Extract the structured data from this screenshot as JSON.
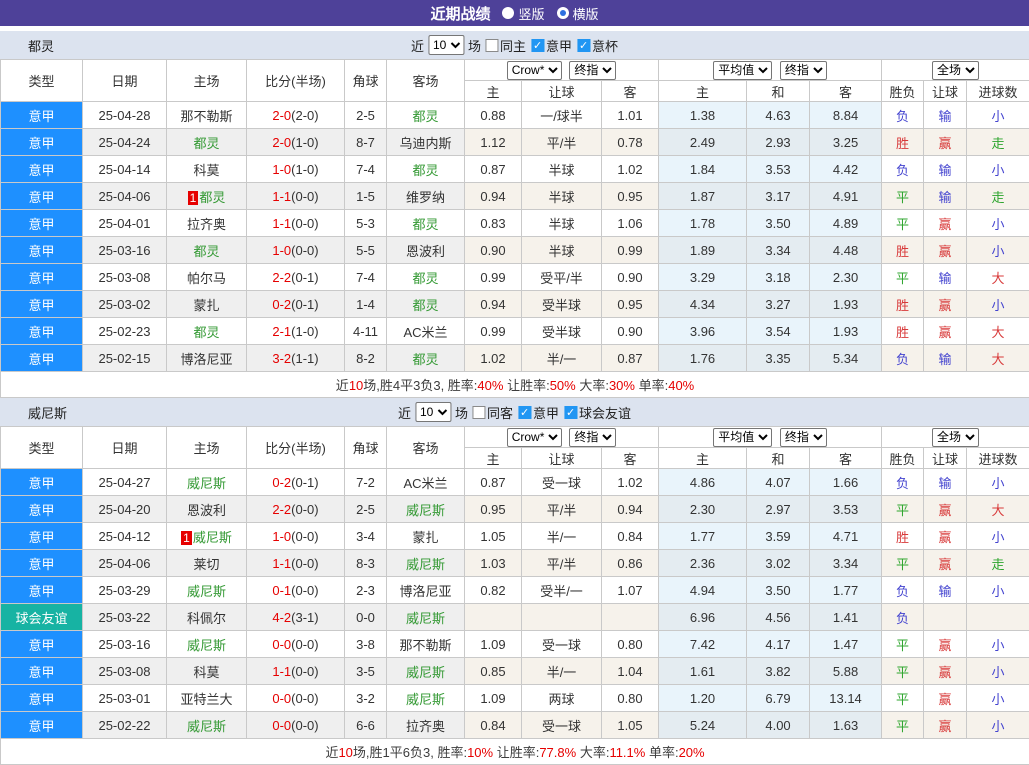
{
  "colors": {
    "title_bg": "#4e4199",
    "section_bg": "#dce3ef",
    "serie_a_cell": "#1E90FF",
    "friendly_cell": "#17b3a3",
    "team_highlight_green": "#339933",
    "score_red": "#e60000",
    "win_red": "#d83a3a",
    "draw_green": "#2ea52e",
    "lose_blue": "#4343cf",
    "avg_col_bg": "#e9f4fb",
    "checkbox_blue": "#2196f3"
  },
  "title_bar": {
    "title": "近期战绩",
    "radios": [
      {
        "label": "竖版",
        "checked": false
      },
      {
        "label": "横版",
        "checked": true
      }
    ]
  },
  "columns": {
    "main": [
      "类型",
      "日期",
      "主场",
      "比分(半场)",
      "角球",
      "客场"
    ],
    "dd": {
      "crow": "Crow*",
      "final1": "终指",
      "avg": "平均值",
      "final2": "终指",
      "full": "全场"
    },
    "sub": [
      "主",
      "让球",
      "客",
      "主",
      "和",
      "客",
      "胜负",
      "让球",
      "进球数"
    ]
  },
  "tables": [
    {
      "team": "都灵",
      "filter": {
        "prefix": "近",
        "count": "10",
        "suffix": "场",
        "checks": [
          {
            "label": "同主",
            "checked": false
          },
          {
            "label": "意甲",
            "checked": true
          },
          {
            "label": "意杯",
            "checked": true
          }
        ]
      },
      "rows": [
        {
          "type": "意甲",
          "style": "serie",
          "date": "25-04-28",
          "home": "那不勒斯",
          "home_green": false,
          "home_badge": "",
          "score_ft": "2-0",
          "score_ht": "(2-0)",
          "corner": "2-5",
          "away": "都灵",
          "away_green": true,
          "crow": [
            "0.88",
            "一/球半",
            "1.01"
          ],
          "avg": [
            "1.38",
            "4.63",
            "8.84"
          ],
          "res": [
            [
              "负",
              "b"
            ],
            [
              "输",
              "b"
            ],
            [
              "小",
              "b"
            ]
          ]
        },
        {
          "type": "意甲",
          "style": "serie",
          "date": "25-04-24",
          "home": "都灵",
          "home_green": true,
          "home_badge": "",
          "score_ft": "2-0",
          "score_ht": "(1-0)",
          "corner": "8-7",
          "away": "乌迪内斯",
          "away_green": false,
          "crow": [
            "1.12",
            "平/半",
            "0.78"
          ],
          "avg": [
            "2.49",
            "2.93",
            "3.25"
          ],
          "res": [
            [
              "胜",
              "r"
            ],
            [
              "赢",
              "r"
            ],
            [
              "走",
              "g"
            ]
          ]
        },
        {
          "type": "意甲",
          "style": "serie",
          "date": "25-04-14",
          "home": "科莫",
          "home_green": false,
          "home_badge": "",
          "score_ft": "1-0",
          "score_ht": "(1-0)",
          "corner": "7-4",
          "away": "都灵",
          "away_green": true,
          "crow": [
            "0.87",
            "半球",
            "1.02"
          ],
          "avg": [
            "1.84",
            "3.53",
            "4.42"
          ],
          "res": [
            [
              "负",
              "b"
            ],
            [
              "输",
              "b"
            ],
            [
              "小",
              "b"
            ]
          ]
        },
        {
          "type": "意甲",
          "style": "serie",
          "date": "25-04-06",
          "home": "都灵",
          "home_green": true,
          "home_badge": "1",
          "score_ft": "1-1",
          "score_ht": "(0-0)",
          "corner": "1-5",
          "away": "维罗纳",
          "away_green": false,
          "crow": [
            "0.94",
            "半球",
            "0.95"
          ],
          "avg": [
            "1.87",
            "3.17",
            "4.91"
          ],
          "res": [
            [
              "平",
              "g"
            ],
            [
              "输",
              "b"
            ],
            [
              "走",
              "g"
            ]
          ]
        },
        {
          "type": "意甲",
          "style": "serie",
          "date": "25-04-01",
          "home": "拉齐奥",
          "home_green": false,
          "home_badge": "",
          "score_ft": "1-1",
          "score_ht": "(0-0)",
          "corner": "5-3",
          "away": "都灵",
          "away_green": true,
          "crow": [
            "0.83",
            "半球",
            "1.06"
          ],
          "avg": [
            "1.78",
            "3.50",
            "4.89"
          ],
          "res": [
            [
              "平",
              "g"
            ],
            [
              "赢",
              "r"
            ],
            [
              "小",
              "b"
            ]
          ]
        },
        {
          "type": "意甲",
          "style": "serie",
          "date": "25-03-16",
          "home": "都灵",
          "home_green": true,
          "home_badge": "",
          "score_ft": "1-0",
          "score_ht": "(0-0)",
          "corner": "5-5",
          "away": "恩波利",
          "away_green": false,
          "crow": [
            "0.90",
            "半球",
            "0.99"
          ],
          "avg": [
            "1.89",
            "3.34",
            "4.48"
          ],
          "res": [
            [
              "胜",
              "r"
            ],
            [
              "赢",
              "r"
            ],
            [
              "小",
              "b"
            ]
          ]
        },
        {
          "type": "意甲",
          "style": "serie",
          "date": "25-03-08",
          "home": "帕尔马",
          "home_green": false,
          "home_badge": "",
          "score_ft": "2-2",
          "score_ht": "(0-1)",
          "corner": "7-4",
          "away": "都灵",
          "away_green": true,
          "crow": [
            "0.99",
            "受平/半",
            "0.90"
          ],
          "avg": [
            "3.29",
            "3.18",
            "2.30"
          ],
          "res": [
            [
              "平",
              "g"
            ],
            [
              "输",
              "b"
            ],
            [
              "大",
              "r"
            ]
          ]
        },
        {
          "type": "意甲",
          "style": "serie",
          "date": "25-03-02",
          "home": "蒙扎",
          "home_green": false,
          "home_badge": "",
          "score_ft": "0-2",
          "score_ht": "(0-1)",
          "corner": "1-4",
          "away": "都灵",
          "away_green": true,
          "crow": [
            "0.94",
            "受半球",
            "0.95"
          ],
          "avg": [
            "4.34",
            "3.27",
            "1.93"
          ],
          "res": [
            [
              "胜",
              "r"
            ],
            [
              "赢",
              "r"
            ],
            [
              "小",
              "b"
            ]
          ]
        },
        {
          "type": "意甲",
          "style": "serie",
          "date": "25-02-23",
          "home": "都灵",
          "home_green": true,
          "home_badge": "",
          "score_ft": "2-1",
          "score_ht": "(1-0)",
          "corner": "4-11",
          "away": "AC米兰",
          "away_green": false,
          "crow": [
            "0.99",
            "受半球",
            "0.90"
          ],
          "avg": [
            "3.96",
            "3.54",
            "1.93"
          ],
          "res": [
            [
              "胜",
              "r"
            ],
            [
              "赢",
              "r"
            ],
            [
              "大",
              "r"
            ]
          ]
        },
        {
          "type": "意甲",
          "style": "serie",
          "date": "25-02-15",
          "home": "博洛尼亚",
          "home_green": false,
          "home_badge": "",
          "score_ft": "3-2",
          "score_ht": "(1-1)",
          "corner": "8-2",
          "away": "都灵",
          "away_green": true,
          "crow": [
            "1.02",
            "半/一",
            "0.87"
          ],
          "avg": [
            "1.76",
            "3.35",
            "5.34"
          ],
          "res": [
            [
              "负",
              "b"
            ],
            [
              "输",
              "b"
            ],
            [
              "大",
              "r"
            ]
          ]
        }
      ],
      "summary": [
        [
          "近",
          0
        ],
        [
          "10",
          1
        ],
        [
          "场,胜4平3负3, 胜率:",
          0
        ],
        [
          "40%",
          1
        ],
        [
          " 让胜率:",
          0
        ],
        [
          "50%",
          1
        ],
        [
          " 大率:",
          0
        ],
        [
          "30%",
          1
        ],
        [
          " 单率:",
          0
        ],
        [
          "40%",
          1
        ]
      ]
    },
    {
      "team": "威尼斯",
      "filter": {
        "prefix": "近",
        "count": "10",
        "suffix": "场",
        "checks": [
          {
            "label": "同客",
            "checked": false
          },
          {
            "label": "意甲",
            "checked": true
          },
          {
            "label": "球会友谊",
            "checked": true
          }
        ]
      },
      "rows": [
        {
          "type": "意甲",
          "style": "serie",
          "date": "25-04-27",
          "home": "威尼斯",
          "home_green": true,
          "home_badge": "",
          "score_ft": "0-2",
          "score_ht": "(0-1)",
          "corner": "7-2",
          "away": "AC米兰",
          "away_green": false,
          "crow": [
            "0.87",
            "受一球",
            "1.02"
          ],
          "avg": [
            "4.86",
            "4.07",
            "1.66"
          ],
          "res": [
            [
              "负",
              "b"
            ],
            [
              "输",
              "b"
            ],
            [
              "小",
              "b"
            ]
          ]
        },
        {
          "type": "意甲",
          "style": "serie",
          "date": "25-04-20",
          "home": "恩波利",
          "home_green": false,
          "home_badge": "",
          "score_ft": "2-2",
          "score_ht": "(0-0)",
          "corner": "2-5",
          "away": "威尼斯",
          "away_green": true,
          "crow": [
            "0.95",
            "平/半",
            "0.94"
          ],
          "avg": [
            "2.30",
            "2.97",
            "3.53"
          ],
          "res": [
            [
              "平",
              "g"
            ],
            [
              "赢",
              "r"
            ],
            [
              "大",
              "r"
            ]
          ]
        },
        {
          "type": "意甲",
          "style": "serie",
          "date": "25-04-12",
          "home": "威尼斯",
          "home_green": true,
          "home_badge": "1",
          "score_ft": "1-0",
          "score_ht": "(0-0)",
          "corner": "3-4",
          "away": "蒙扎",
          "away_green": false,
          "crow": [
            "1.05",
            "半/一",
            "0.84"
          ],
          "avg": [
            "1.77",
            "3.59",
            "4.71"
          ],
          "res": [
            [
              "胜",
              "r"
            ],
            [
              "赢",
              "r"
            ],
            [
              "小",
              "b"
            ]
          ]
        },
        {
          "type": "意甲",
          "style": "serie",
          "date": "25-04-06",
          "home": "莱切",
          "home_green": false,
          "home_badge": "",
          "score_ft": "1-1",
          "score_ht": "(0-0)",
          "corner": "8-3",
          "away": "威尼斯",
          "away_green": true,
          "crow": [
            "1.03",
            "平/半",
            "0.86"
          ],
          "avg": [
            "2.36",
            "3.02",
            "3.34"
          ],
          "res": [
            [
              "平",
              "g"
            ],
            [
              "赢",
              "r"
            ],
            [
              "走",
              "g"
            ]
          ]
        },
        {
          "type": "意甲",
          "style": "serie",
          "date": "25-03-29",
          "home": "威尼斯",
          "home_green": true,
          "home_badge": "",
          "score_ft": "0-1",
          "score_ht": "(0-0)",
          "corner": "2-3",
          "away": "博洛尼亚",
          "away_green": false,
          "crow": [
            "0.82",
            "受半/一",
            "1.07"
          ],
          "avg": [
            "4.94",
            "3.50",
            "1.77"
          ],
          "res": [
            [
              "负",
              "b"
            ],
            [
              "输",
              "b"
            ],
            [
              "小",
              "b"
            ]
          ]
        },
        {
          "type": "球会友谊",
          "style": "friendly",
          "date": "25-03-22",
          "home": "科佩尔",
          "home_green": false,
          "home_badge": "",
          "score_ft": "4-2",
          "score_ht": "(3-1)",
          "corner": "0-0",
          "away": "威尼斯",
          "away_green": true,
          "crow": [
            "",
            "",
            ""
          ],
          "avg": [
            "6.96",
            "4.56",
            "1.41"
          ],
          "res": [
            [
              "负",
              "b"
            ],
            [
              "",
              ""
            ],
            [
              "",
              ""
            ]
          ]
        },
        {
          "type": "意甲",
          "style": "serie",
          "date": "25-03-16",
          "home": "威尼斯",
          "home_green": true,
          "home_badge": "",
          "score_ft": "0-0",
          "score_ht": "(0-0)",
          "corner": "3-8",
          "away": "那不勒斯",
          "away_green": false,
          "crow": [
            "1.09",
            "受一球",
            "0.80"
          ],
          "avg": [
            "7.42",
            "4.17",
            "1.47"
          ],
          "res": [
            [
              "平",
              "g"
            ],
            [
              "赢",
              "r"
            ],
            [
              "小",
              "b"
            ]
          ]
        },
        {
          "type": "意甲",
          "style": "serie",
          "date": "25-03-08",
          "home": "科莫",
          "home_green": false,
          "home_badge": "",
          "score_ft": "1-1",
          "score_ht": "(0-0)",
          "corner": "3-5",
          "away": "威尼斯",
          "away_green": true,
          "crow": [
            "0.85",
            "半/一",
            "1.04"
          ],
          "avg": [
            "1.61",
            "3.82",
            "5.88"
          ],
          "res": [
            [
              "平",
              "g"
            ],
            [
              "赢",
              "r"
            ],
            [
              "小",
              "b"
            ]
          ]
        },
        {
          "type": "意甲",
          "style": "serie",
          "date": "25-03-01",
          "home": "亚特兰大",
          "home_green": false,
          "home_badge": "",
          "score_ft": "0-0",
          "score_ht": "(0-0)",
          "corner": "3-2",
          "away": "威尼斯",
          "away_green": true,
          "crow": [
            "1.09",
            "两球",
            "0.80"
          ],
          "avg": [
            "1.20",
            "6.79",
            "13.14"
          ],
          "res": [
            [
              "平",
              "g"
            ],
            [
              "赢",
              "r"
            ],
            [
              "小",
              "b"
            ]
          ]
        },
        {
          "type": "意甲",
          "style": "serie",
          "date": "25-02-22",
          "home": "威尼斯",
          "home_green": true,
          "home_badge": "",
          "score_ft": "0-0",
          "score_ht": "(0-0)",
          "corner": "6-6",
          "away": "拉齐奥",
          "away_green": false,
          "crow": [
            "0.84",
            "受一球",
            "1.05"
          ],
          "avg": [
            "5.24",
            "4.00",
            "1.63"
          ],
          "res": [
            [
              "平",
              "g"
            ],
            [
              "赢",
              "r"
            ],
            [
              "小",
              "b"
            ]
          ]
        }
      ],
      "summary": [
        [
          "近",
          0
        ],
        [
          "10",
          1
        ],
        [
          "场,胜1平6负3, 胜率:",
          0
        ],
        [
          "10%",
          1
        ],
        [
          " 让胜率:",
          0
        ],
        [
          "77.8%",
          1
        ],
        [
          " 大率:",
          0
        ],
        [
          "11.1%",
          1
        ],
        [
          " 单率:",
          0
        ],
        [
          "20%",
          1
        ]
      ]
    }
  ]
}
